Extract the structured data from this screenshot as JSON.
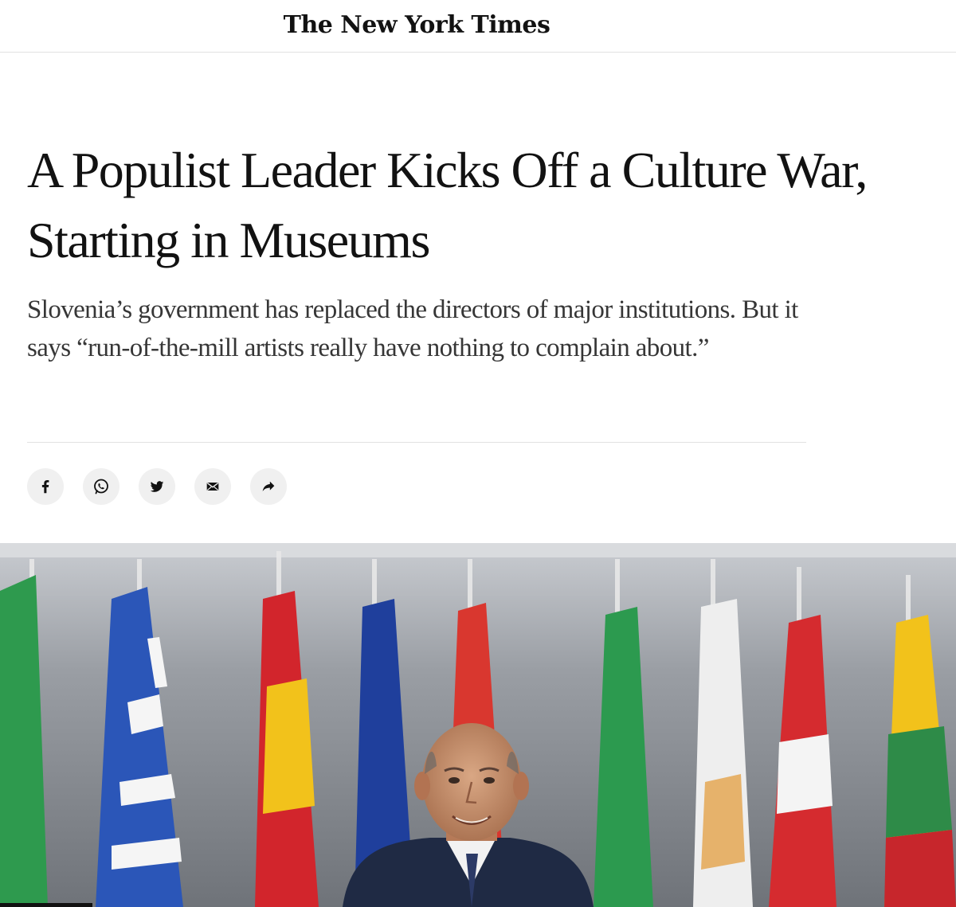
{
  "masthead": {
    "logo_text": "The New York Times"
  },
  "article": {
    "headline": "A Populist Leader Kicks Off a Culture War, Starting in Museums",
    "summary": "Slovenia’s government has replaced the directors of major institutions. But it says “run-of-the-mill artists really have nothing to complain about.”"
  },
  "share": {
    "buttons": [
      {
        "icon": "facebook-icon"
      },
      {
        "icon": "whatsapp-icon"
      },
      {
        "icon": "twitter-icon"
      },
      {
        "icon": "email-icon"
      },
      {
        "icon": "share-arrow-icon"
      }
    ]
  },
  "hero": {
    "description_icon": "photo-of-man-before-eu-flags",
    "colors": {
      "background": "#8f949a",
      "flag_green": "#2e9a4e",
      "flag_blue": "#1f3f9c",
      "flag_red": "#d2252c",
      "flag_yellow": "#f2c21b",
      "flag_orange": "#e87b26"
    }
  }
}
